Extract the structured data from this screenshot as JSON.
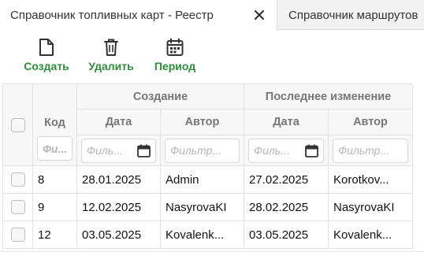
{
  "tabs": [
    {
      "label": "Справочник топливных карт - Реестр",
      "active": true,
      "closable": true
    },
    {
      "label": "Справочник маршрутов",
      "active": false
    }
  ],
  "toolbar": {
    "create_label": "Создать",
    "delete_label": "Удалить",
    "period_label": "Период",
    "icons": {
      "create": "new-document-icon",
      "delete": "trash-icon",
      "period": "calendar-icon"
    },
    "accent_color": "#2e8b3a"
  },
  "grid": {
    "group_headers": {
      "created": "Создание",
      "modified": "Последнее изменение"
    },
    "columns": {
      "code": "Код",
      "created_date": "Дата",
      "created_author": "Автор",
      "modified_date": "Дата",
      "modified_author": "Автор"
    },
    "filters": {
      "code": "Фи...",
      "created_date": "Филь...",
      "created_author": "Фильтр...",
      "modified_date": "Филь...",
      "modified_author": "Фильтр..."
    },
    "rows": [
      {
        "code": "8",
        "created_date": "28.01.2025",
        "created_author": "Admin",
        "modified_date": "27.02.2025",
        "modified_author": "Korotkov..."
      },
      {
        "code": "9",
        "created_date": "12.02.2025",
        "created_author": "NasyrovaKI",
        "modified_date": "28.02.2025",
        "modified_author": "NasyrovaKI"
      },
      {
        "code": "12",
        "created_date": "03.05.2025",
        "created_author": "Kovalenk...",
        "modified_date": "03.05.2025",
        "modified_author": "Kovalenk..."
      }
    ]
  }
}
